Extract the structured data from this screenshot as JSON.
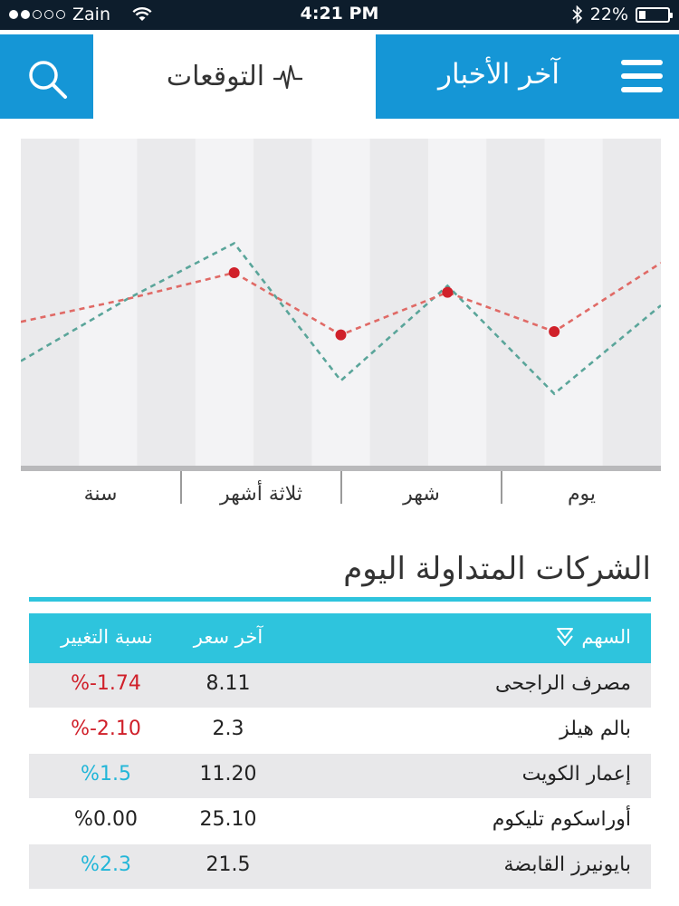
{
  "status_bar": {
    "carrier": "Zain",
    "time": "4:21 PM",
    "battery": "22%",
    "battery_level": 0.22,
    "signal_bars": 2
  },
  "header": {
    "forecast_tab": "التوقعات",
    "news_tab": "آخر الأخبار"
  },
  "colors": {
    "accent_blue": "#1596d6",
    "accent_cyan": "#2ec4dd",
    "negative": "#d0202a",
    "positive": "#22b6d8",
    "series_red": "#e06a66",
    "series_green": "#5aa59a"
  },
  "chart_data": {
    "type": "line",
    "x": [
      0,
      1,
      2,
      3,
      4,
      5,
      6
    ],
    "ylim": [
      0,
      100
    ],
    "grid": false,
    "series": [
      {
        "values": [
          44,
          51,
          59,
          40,
          53,
          41,
          62
        ],
        "markers_at": [
          2,
          3,
          4,
          5
        ]
      },
      {
        "values": [
          32,
          51,
          68,
          26,
          55,
          22,
          49
        ]
      }
    ]
  },
  "period_tabs": [
    {
      "id": "year",
      "label": "سنة"
    },
    {
      "id": "three-months",
      "label": "ثلاثة أشهر"
    },
    {
      "id": "month",
      "label": "شهر"
    },
    {
      "id": "day",
      "label": "يوم"
    }
  ],
  "section": {
    "title": "الشركات المتداولة اليوم"
  },
  "table": {
    "headers": {
      "stock": "السهم",
      "last_price": "آخر سعر",
      "change": "نسبة التغيير"
    },
    "rows": [
      {
        "name": "مصرف الراجحى",
        "price": "8.11",
        "change": "%-1.74",
        "direction": "neg"
      },
      {
        "name": "بالم هيلز",
        "price": "2.3",
        "change": "%-2.10",
        "direction": "neg"
      },
      {
        "name": "إعمار الكويت",
        "price": "11.20",
        "change": "%1.5",
        "direction": "pos"
      },
      {
        "name": "أوراسكوم تليكوم",
        "price": "25.10",
        "change": "%0.00",
        "direction": "zero"
      },
      {
        "name": "بايونيرز القابضة",
        "price": "21.5",
        "change": "%2.3",
        "direction": "pos"
      }
    ]
  }
}
